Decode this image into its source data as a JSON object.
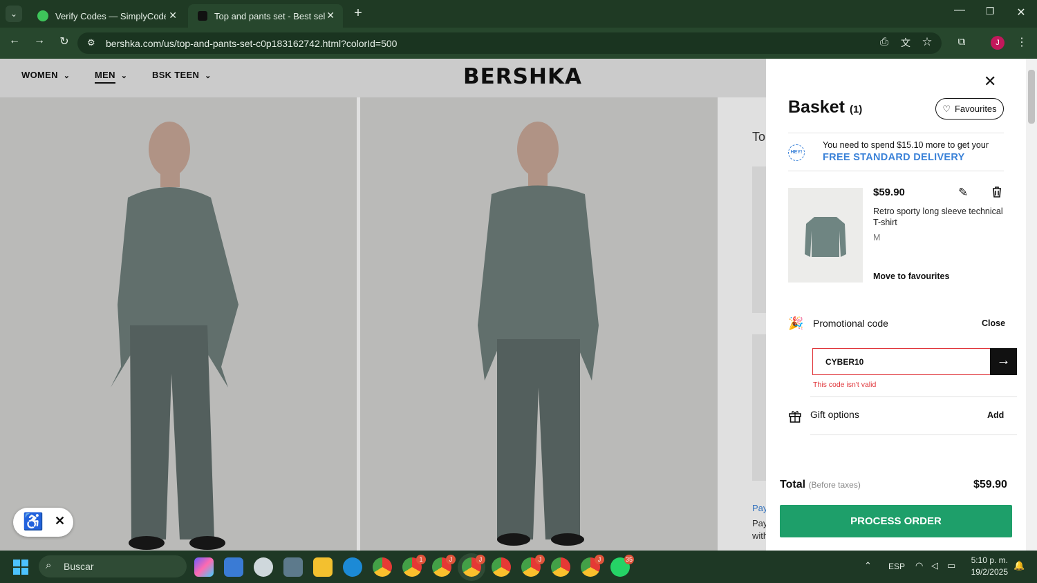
{
  "browser": {
    "tabs": [
      {
        "title": "Verify Codes — SimplyCodes",
        "active": false
      },
      {
        "title": "Top and pants set - Best sellers",
        "active": true
      }
    ],
    "url": "bershka.com/us/top-and-pants-set-c0p183162742.html?colorId=500"
  },
  "site": {
    "nav": [
      {
        "label": "WOMEN"
      },
      {
        "label": "MEN"
      },
      {
        "label": "BSK TEEN"
      }
    ],
    "logo": "BERSHKA",
    "peek": {
      "title_fragment": "To",
      "pay1": "Pay",
      "pay2": "Pay",
      "with": "with"
    }
  },
  "basket": {
    "title": "Basket",
    "count": "(1)",
    "favourites_label": "Favourites",
    "hey_badge": "HEY!",
    "delivery_note": "You need to spend $15.10 more to get your",
    "delivery_highlight": "FREE STANDARD DELIVERY",
    "item": {
      "price": "$59.90",
      "name": "Retro sporty long sleeve technical T-shirt",
      "size": "M",
      "move_label": "Move to favourites"
    },
    "promo": {
      "label": "Promotional code",
      "close_label": "Close",
      "value": "CYBER10",
      "error": "This code isn't valid"
    },
    "gift": {
      "label": "Gift options",
      "add_label": "Add"
    },
    "total": {
      "label": "Total",
      "note": "(Before taxes)",
      "value": "$59.90"
    },
    "process_label": "PROCESS ORDER"
  },
  "taskbar": {
    "search_placeholder": "Buscar",
    "badges": {
      "chrome1": "1",
      "chrome2": "J",
      "chrome3": "J",
      "chrome4": "J",
      "chrome5": "J",
      "whatsapp": "35"
    },
    "lang": "ESP",
    "time": "5:10 p. m.",
    "date": "19/2/2025"
  },
  "colors": {
    "accent_green": "#1e9f6a",
    "link_blue": "#3b82d8",
    "error_red": "#e0353a",
    "chrome_dark": "#1f3a24"
  }
}
